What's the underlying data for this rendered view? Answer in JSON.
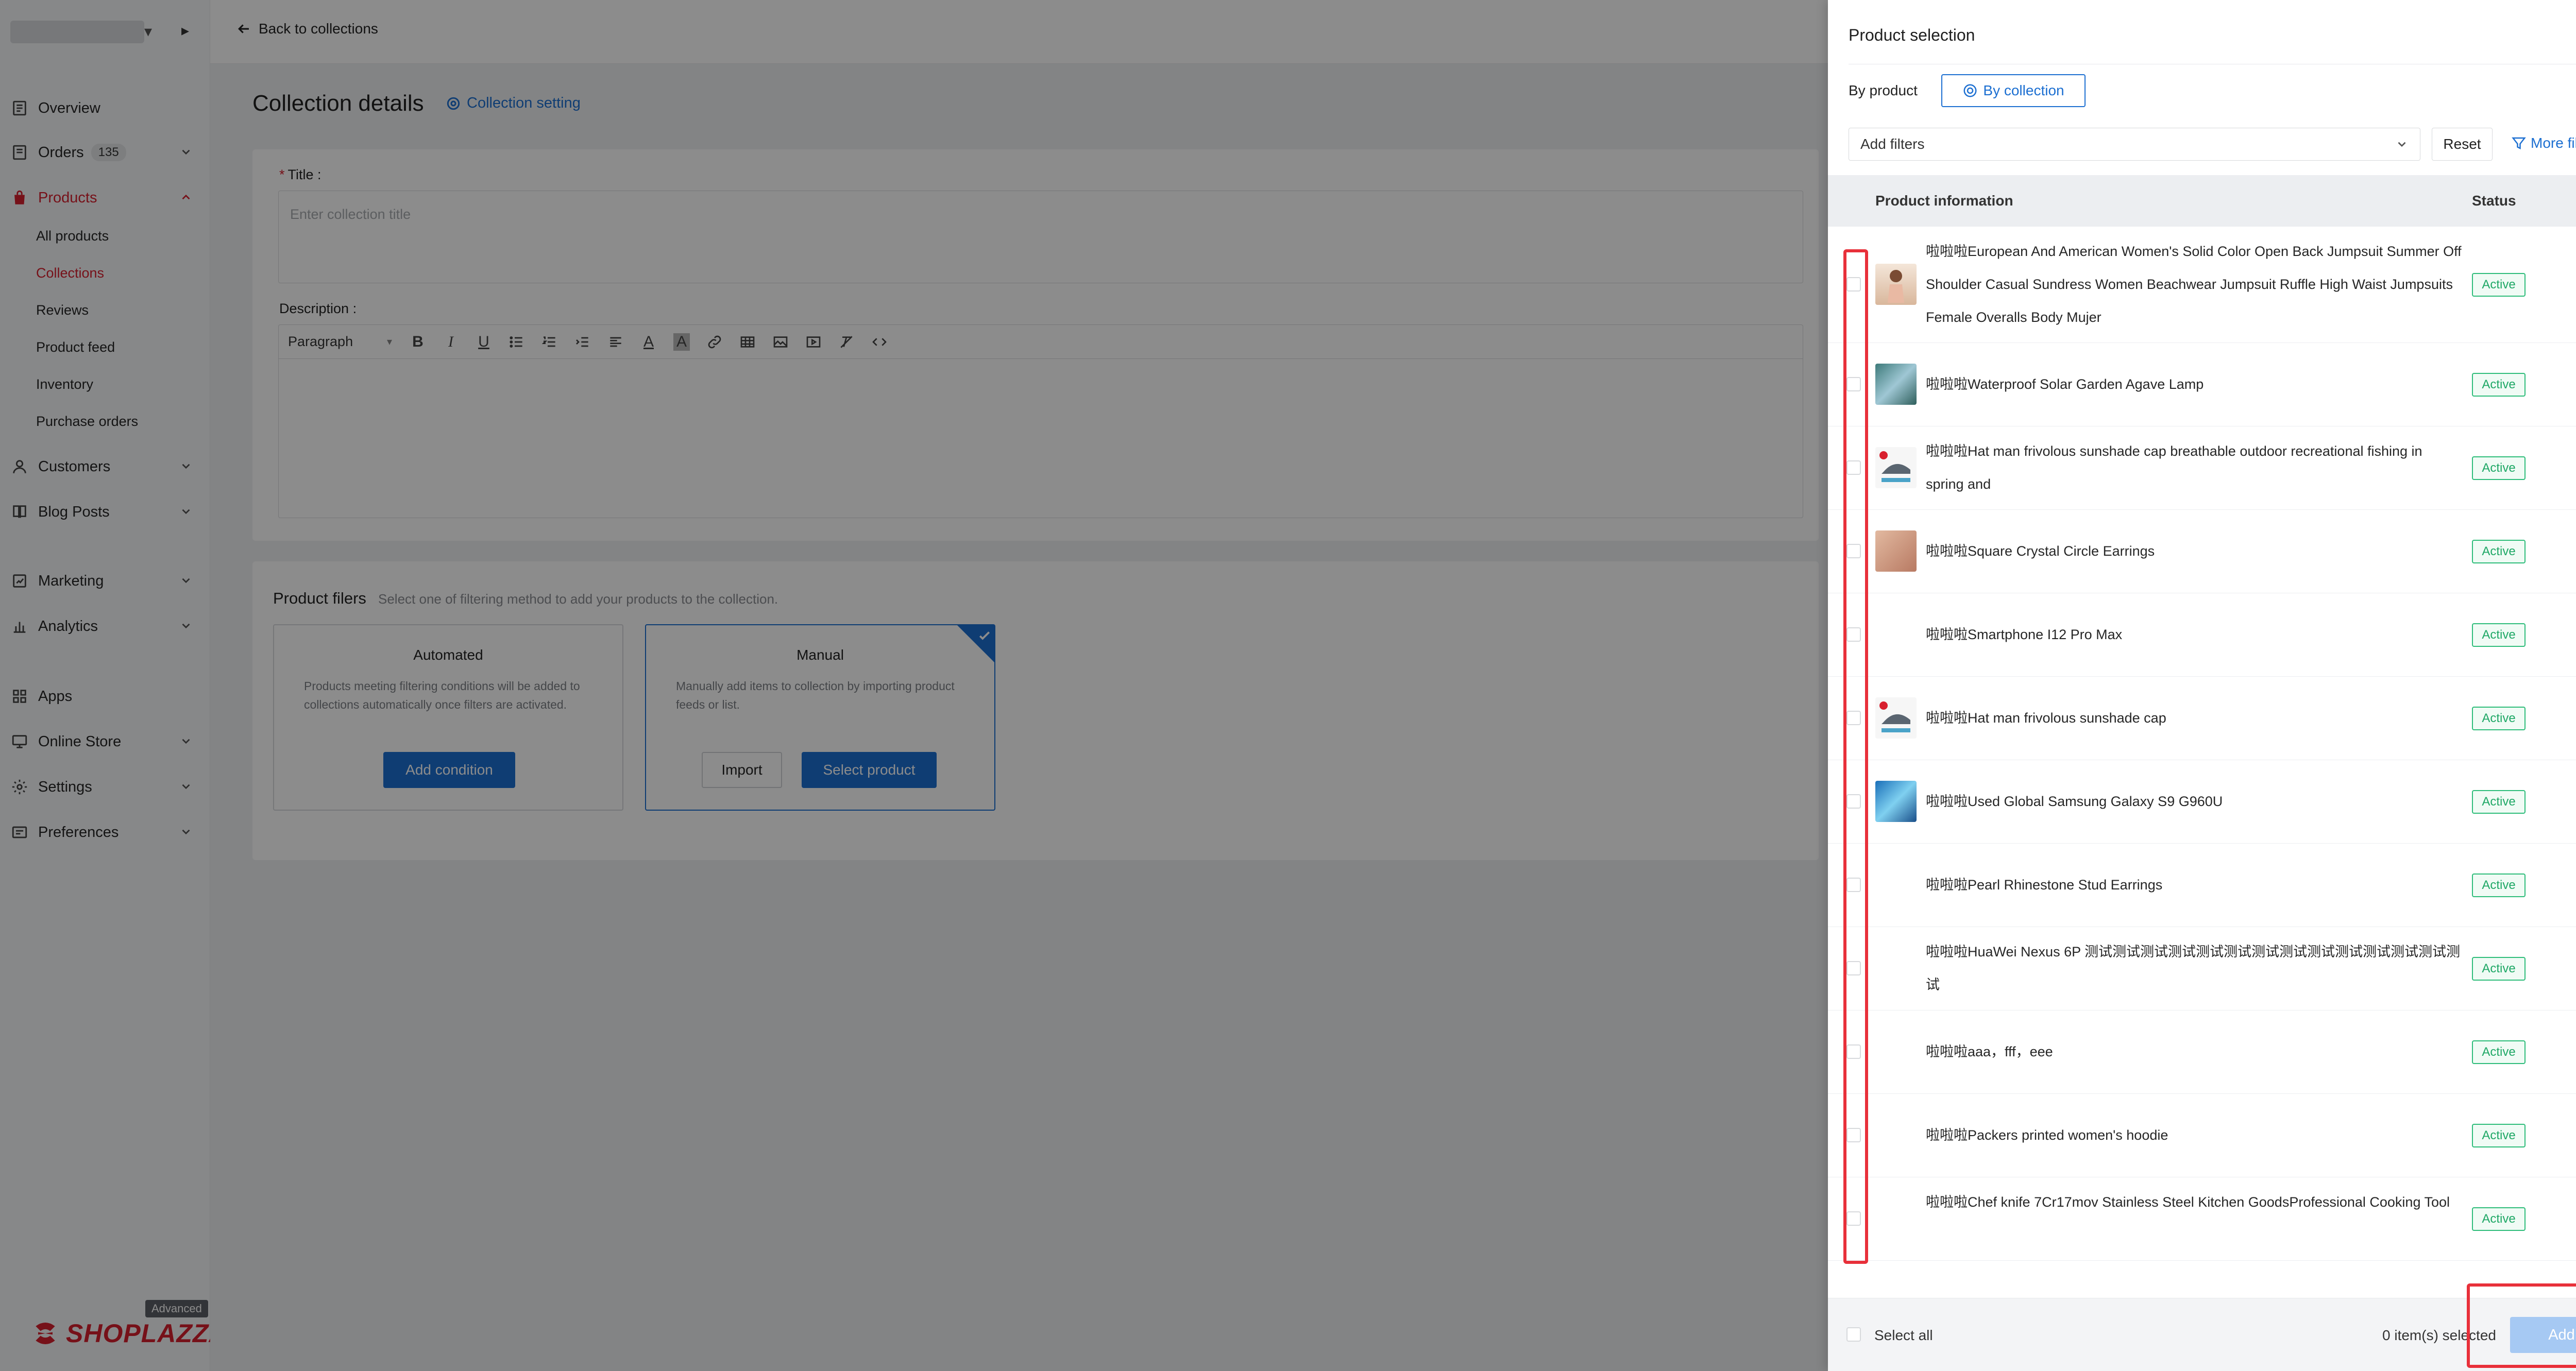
{
  "sidebar": {
    "nav": {
      "overview": "Overview",
      "orders": "Orders",
      "orders_badge": "135",
      "products": "Products",
      "customers": "Customers",
      "blog_posts": "Blog Posts",
      "marketing": "Marketing",
      "analytics": "Analytics",
      "apps": "Apps",
      "online_store": "Online Store",
      "settings": "Settings",
      "preferences": "Preferences"
    },
    "products_sub": {
      "all_products": "All products",
      "collections": "Collections",
      "reviews": "Reviews",
      "product_feed": "Product feed",
      "inventory": "Inventory",
      "purchase_orders": "Purchase orders"
    },
    "logo_text": "SHOPLAZZA",
    "plan_badge": "Advanced"
  },
  "main": {
    "back_link": "Back to collections",
    "page_title": "Collection details",
    "collection_setting": "Collection setting",
    "title_label": "Title",
    "title_required_mark": "*",
    "title_placeholder": "Enter collection title",
    "description_label": "Description",
    "editor_paragraph": "Paragraph",
    "product_filters_title": "Product filers",
    "product_filters_sub": "Select one of filtering method to add your products to the collection.",
    "automated": {
      "title": "Automated",
      "desc": "Products meeting filtering conditions will be added to collections automatically once filters are activated.",
      "button": "Add condition"
    },
    "manual": {
      "title": "Manual",
      "desc": "Manually add items to collection by importing product feeds or list.",
      "import_button": "Import",
      "select_button": "Select product"
    }
  },
  "drawer": {
    "title": "Product selection",
    "mode_label": "By product",
    "mode_button": "By collection",
    "filter_placeholder": "Add filters",
    "reset": "Reset",
    "more_filters": "More filters",
    "col_product": "Product information",
    "col_status": "Status",
    "products": [
      {
        "name": "啦啦啦European And American Women's Solid Color Open Back Jumpsuit Summer Off Shoulder Casual Sundress Women Beachwear Jumpsuit Ruffle High Waist Jumpsuits Female Overalls Body Mujer",
        "status": "Active"
      },
      {
        "name": "啦啦啦Waterproof Solar Garden Agave Lamp",
        "status": "Active"
      },
      {
        "name": "啦啦啦Hat man frivolous sunshade cap breathable outdoor recreational fishing in spring and",
        "status": "Active"
      },
      {
        "name": "啦啦啦Square Crystal Circle Earrings",
        "status": "Active"
      },
      {
        "name": "啦啦啦Smartphone I12 Pro Max",
        "status": "Active"
      },
      {
        "name": "啦啦啦Hat man frivolous sunshade cap",
        "status": "Active"
      },
      {
        "name": "啦啦啦Used Global Samsung Galaxy S9 G960U",
        "status": "Active"
      },
      {
        "name": "啦啦啦Pearl Rhinestone Stud Earrings",
        "status": "Active"
      },
      {
        "name": "啦啦啦HuaWei Nexus 6P 测试测试测试测试测试测试测试测试测试测试测试测试测试测试",
        "status": "Active"
      },
      {
        "name": "啦啦啦aaa，fff，eee",
        "status": "Active"
      },
      {
        "name": "啦啦啦Packers printed women's hoodie",
        "status": "Active"
      },
      {
        "name": "啦啦啦Chef knife 7Cr17mov Stainless Steel Kitchen GoodsProfessional Cooking Tool",
        "status": "Active"
      }
    ],
    "select_all": "Select all",
    "selected_count": "0 item(s) selected",
    "add_button": "Add"
  },
  "colors": {
    "brand_red": "#d8202f",
    "primary_blue": "#1c6fd1",
    "status_green": "#1fa866",
    "annotation_red": "#e8303a",
    "disabled_blue": "#a6c9f3"
  }
}
